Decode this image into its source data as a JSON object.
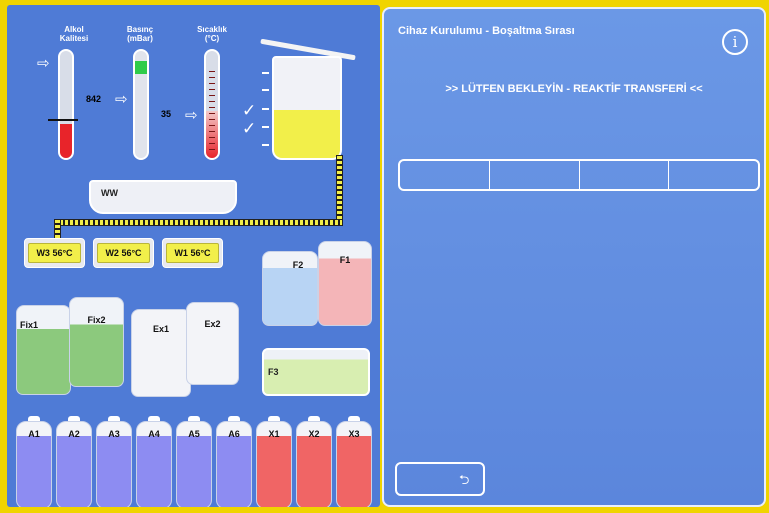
{
  "gauges": {
    "alcohol": {
      "label_line1": "Alkol",
      "label_line2": "Kalitesi",
      "value": "842"
    },
    "pressure": {
      "label_line1": "Basınç",
      "label_line2": "(mBar)",
      "value": "35"
    },
    "temperature": {
      "label_line1": "Sıcaklık",
      "label_line2": "(°C)"
    }
  },
  "wax_bath": {
    "label": "WW"
  },
  "wax_stations": [
    {
      "label": "W3  56°C"
    },
    {
      "label": "W2  56°C"
    },
    {
      "label": "W1  56°C"
    }
  ],
  "bottles": {
    "formalin": {
      "f1": "F1",
      "f2": "F2",
      "f3": "F3"
    },
    "fixative": {
      "fix1": "Fix1",
      "fix2": "Fix2"
    },
    "extra": {
      "ex1": "Ex1",
      "ex2": "Ex2"
    },
    "reagents": [
      "A1",
      "A2",
      "A3",
      "A4",
      "A5",
      "A6",
      "X1",
      "X2",
      "X3"
    ]
  },
  "panel": {
    "title": "Cihaz Kurulumu - Boşaltma Sırası",
    "status": ">> LÜTFEN BEKLEYİN - REAKTİF TRANSFERİ <<",
    "info_icon": "i",
    "back_icon": "⮌"
  },
  "colors": {
    "accent_blue": "#4f7bd6",
    "frame_yellow": "#f0d400",
    "alcohol_red": "#e8242a",
    "pressure_green": "#2fcc4a",
    "wax_yellow": "#f2ef4a",
    "formalin_blue": "#b8d4f4",
    "formalin_pink": "#f4b5b8",
    "green_fill": "#8cc97d",
    "reagent_violet": "#8d8cf2",
    "reagent_red": "#f06565"
  }
}
